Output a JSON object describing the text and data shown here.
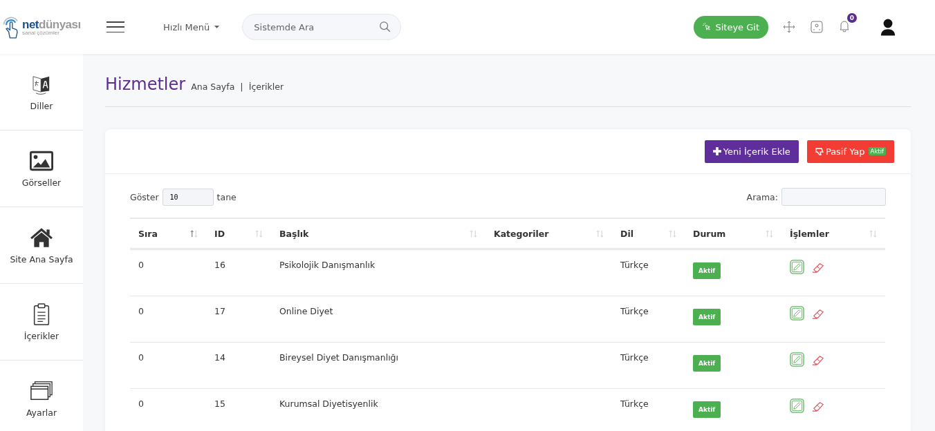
{
  "logo": {
    "brand_bold": "net",
    "brand_light": "dünyası",
    "tagline": "sanal çözümler"
  },
  "topbar": {
    "quick_menu": "Hızlı Menü",
    "search": {
      "placeholder": "Sistemde Ara"
    },
    "site_button": "Siteye Git",
    "notification_count": "0"
  },
  "sidebar": {
    "items": [
      {
        "label": "Diller"
      },
      {
        "label": "Görseller"
      },
      {
        "label": "Site Ana Sayfa"
      },
      {
        "label": "İçerikler"
      },
      {
        "label": "Ayarlar"
      }
    ]
  },
  "page": {
    "title": "Hizmetler",
    "breadcrumb": [
      "Ana Sayfa",
      "İçerikler"
    ],
    "breadcrumb_separator": "|"
  },
  "actions": {
    "add_button": "Yeni İçerik Ekle",
    "passive_button": "Pasif Yap",
    "passive_badge": "Aktif"
  },
  "table_controls": {
    "show_label": "Göster",
    "page_size": "10",
    "show_suffix": "tane",
    "search_label": "Arama:"
  },
  "table": {
    "columns": [
      {
        "label": "Sıra",
        "sorted": true
      },
      {
        "label": "ID",
        "sorted": false
      },
      {
        "label": "Başlık",
        "sorted": false
      },
      {
        "label": "Kategoriler",
        "sorted": false
      },
      {
        "label": "Dil",
        "sorted": false
      },
      {
        "label": "Durum",
        "sorted": false
      },
      {
        "label": "İşlemler",
        "sorted": false
      }
    ],
    "rows": [
      {
        "order": "0",
        "id": "16",
        "title": "Psikolojik Danışmanlık",
        "language": "Türkçe",
        "status": "Aktif"
      },
      {
        "order": "0",
        "id": "17",
        "title": "Online Diyet",
        "language": "Türkçe",
        "status": "Aktif"
      },
      {
        "order": "0",
        "id": "14",
        "title": "Bireysel Diyet Danışmanlığı",
        "language": "Türkçe",
        "status": "Aktif"
      },
      {
        "order": "0",
        "id": "15",
        "title": "Kurumsal Diyetisyenlik",
        "language": "Türkçe",
        "status": "Aktif"
      }
    ]
  }
}
